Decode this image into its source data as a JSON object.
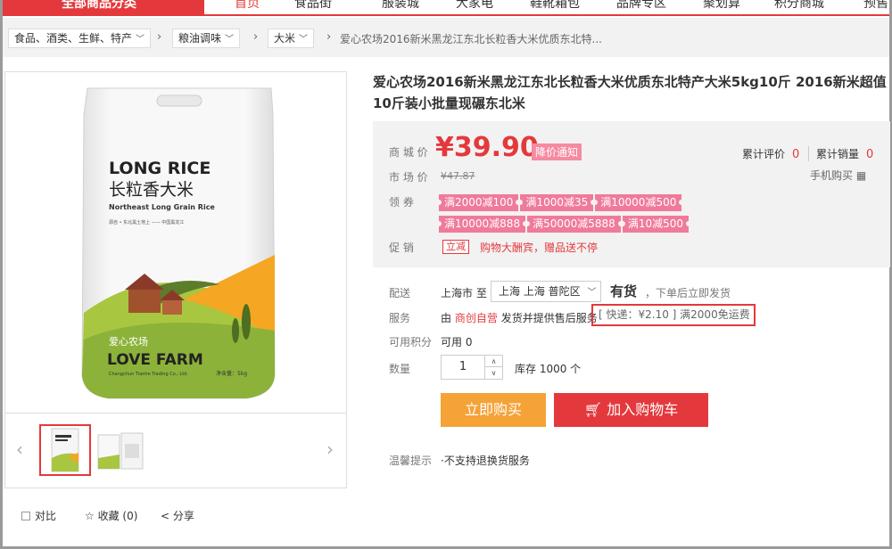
{
  "nav": {
    "all_categories": "全部商品分类",
    "items": [
      "首页",
      "食品街",
      "服装城",
      "大家电",
      "鞋靴箱包",
      "品牌专区",
      "聚划算",
      "积分商城",
      "预售"
    ]
  },
  "breadcrumb": {
    "cat1": "食品、酒类、生鲜、特产",
    "cat2": "粮油调味",
    "cat3": "大米",
    "current": "爱心农场2016新米黑龙江东北长粒香大米优质东北特..."
  },
  "product": {
    "title": "爱心农场2016新米黑龙江东北长粒香大米优质东北特产大米5kg10斤 2016新米超值10斤装小批量现碾东北米",
    "package": {
      "brand_en": "LONG RICE",
      "brand_cn": "长粒香大米",
      "subtitle": "Northeast Long Grain Rice",
      "farm_cn": "爱心农场",
      "farm_en": "LOVE FARM",
      "company": "Changchun Tianhe Trading Co., Ltd.",
      "weight": "净含量：5kg",
      "small_line": "源自 • 东北黑土地上 —— 中国黑龙江"
    }
  },
  "price": {
    "label": "商 城 价",
    "value": "¥39.90",
    "notify": "降价通知",
    "market_label": "市 场 价",
    "market_value": "¥47.87",
    "coupon_label": "领 券",
    "coupons": [
      "满2000减100",
      "满1000减35",
      "满10000减500",
      "满10000减888",
      "满50000减5888",
      "满10减500"
    ],
    "promo_label": "促 销",
    "promo_tag": "立减",
    "promo_text": "购物大酬宾，赠品送不停",
    "review_label": "累计评价",
    "review_count": "0",
    "sales_label": "累计销量",
    "sales_count": "0",
    "mobile_buy": "手机购买"
  },
  "delivery": {
    "label": "配送",
    "from": "上海市",
    "to_word": "至",
    "address": "上海 上海 普陀区",
    "stock": "有货",
    "note": "，下单后立即发货"
  },
  "service": {
    "label": "服务",
    "prefix": "由",
    "seller": "商创自营",
    "suffix": "发货并提供售后服务",
    "shipping": "[ 快递：¥2.10 ]  满2000免运费"
  },
  "points": {
    "label": "可用积分",
    "value": "可用 0"
  },
  "quantity": {
    "label": "数量",
    "value": "1",
    "stock": "库存 1000 个"
  },
  "buttons": {
    "buy_now": "立即购买",
    "add_cart": "加入购物车"
  },
  "tips": {
    "label": "温馨提示",
    "text": "·不支持退换货服务"
  },
  "actions": {
    "compare": "对比",
    "favorite": "收藏 (0)",
    "share": "分享"
  },
  "colors": {
    "accent": "#e4393c",
    "buy": "#f5a237",
    "coupon": "#f07a9a"
  }
}
